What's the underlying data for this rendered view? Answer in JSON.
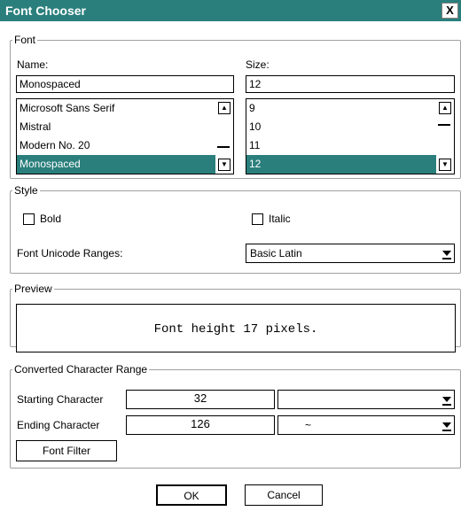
{
  "window": {
    "title": "Font Chooser",
    "close_glyph": "X"
  },
  "font_group": {
    "legend": "Font",
    "name_label": "Name:",
    "size_label": "Size:",
    "name_value": "Monospaced",
    "size_value": "12",
    "names": [
      "Microsoft Sans Serif",
      "Mistral",
      "Modern No. 20",
      "Monospaced"
    ],
    "sizes": [
      "9",
      "10",
      "11",
      "12"
    ],
    "selected_name": "Monospaced",
    "selected_size": "12"
  },
  "style_group": {
    "legend": "Style",
    "bold_label": "Bold",
    "italic_label": "Italic",
    "bold_checked": false,
    "italic_checked": false,
    "unicode_label": "Font Unicode Ranges:",
    "unicode_value": "Basic Latin"
  },
  "preview_group": {
    "legend": "Preview",
    "text": "Font height 17 pixels."
  },
  "range_group": {
    "legend": "Converted Character Range",
    "start_label": "Starting Character",
    "start_value": "32",
    "start_char": "",
    "end_label": "Ending Character",
    "end_value": "126",
    "end_char": "~",
    "filter_label": "Font Filter"
  },
  "buttons": {
    "ok": "OK",
    "cancel": "Cancel"
  },
  "colors": {
    "title_bar": "#2a7f7c",
    "selection": "#2a7f7c"
  },
  "icons": {
    "close": "close-icon",
    "scroll_up": "scroll-up-icon",
    "scroll_down": "scroll-down-icon",
    "dropdown": "dropdown-arrow-icon"
  }
}
